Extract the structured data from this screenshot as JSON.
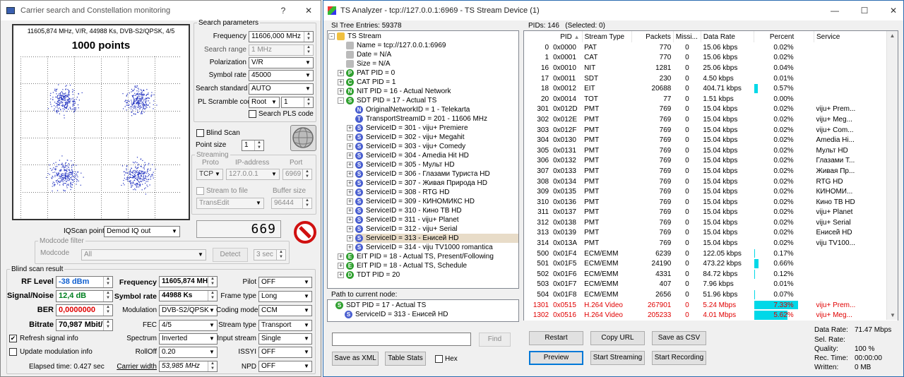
{
  "left_window": {
    "title": "Carrier search and Constellation monitoring",
    "help": "?",
    "close": "✕",
    "constellation": {
      "header": "11605,874 MHz, V/R, 44988 Ks, DVB-S2/QPSK, 4/5",
      "points_label": "1000 points"
    },
    "search_params": {
      "legend": "Search parameters",
      "frequency_label": "Frequency",
      "frequency_value": "11606,000 MHz",
      "search_range_label": "Search range",
      "search_range_value": "1 MHz",
      "polarization_label": "Polarization",
      "polarization_value": "V/R",
      "symbol_rate_label": "Symbol rate",
      "symbol_rate_value": "45000",
      "search_standard_label": "Search standard",
      "search_standard_value": "AUTO",
      "pl_scramble_label": "PL Scramble code",
      "pl_scramble_mode": "Root",
      "pl_scramble_value": "1",
      "search_pls_label": "Search PLS code"
    },
    "blind_scan_label": "Blind Scan",
    "point_size_label": "Point size",
    "point_size_value": "1",
    "streaming": {
      "legend": "Streaming",
      "proto_label": "Proto",
      "ip_label": "IP-address",
      "port_label": "Port",
      "proto_value": "TCP",
      "ip_value": "127.0.0.1",
      "port_value": "6969",
      "stream_to_file_label": "Stream to file",
      "buffer_size_label": "Buffer size",
      "file_value": "TransEdit",
      "buffer_value": "96444"
    },
    "counter_value": "669",
    "iqscan_label": "IQScan point",
    "iqscan_value": "Demod IQ out",
    "modcode_filter": {
      "legend": "Modcode filter",
      "modcode_label": "Modcode",
      "modcode_value": "All",
      "detect_label": "Detect",
      "sec_value": "3 sec"
    },
    "blind_result": {
      "legend": "Blind scan result",
      "rf_level_label": "RF Level",
      "rf_level_value": "-38 dBm",
      "sn_label": "Signal/Noise",
      "sn_value": "12,4 dB",
      "ber_label": "BER",
      "ber_value": "0,0000000",
      "bitrate_label": "Bitrate",
      "bitrate_value": "70,987 Mbit/",
      "refresh_label": "Refresh signal info",
      "update_mod_label": "Update modulation info",
      "elapsed": "Elapsed time: 0.427 sec",
      "frequency_label": "Frequency",
      "frequency_value": "11605,874 MH",
      "symbol_rate_label": "Symbol rate",
      "symbol_rate_value": "44988 Ks",
      "modulation_label": "Modulation",
      "modulation_value": "DVB-S2/QPSK",
      "fec_label": "FEC",
      "fec_value": "4/5",
      "spectrum_label": "Spectrum",
      "spectrum_value": "Inverted",
      "rolloff_label": "RollOff",
      "rolloff_value": "0.20",
      "carrier_width_label": "Carrier width",
      "carrier_width_value": "53,985 MHz",
      "pilot_label": "Pilot",
      "pilot_value": "OFF",
      "frame_type_label": "Frame type",
      "frame_type_value": "Long",
      "coding_mode_label": "Coding mode",
      "coding_mode_value": "CCM",
      "stream_type_label": "Stream type",
      "stream_type_value": "Transport",
      "input_stream_label": "Input stream",
      "input_stream_value": "Single",
      "issyi_label": "ISSYI",
      "issyi_value": "OFF",
      "npd_label": "NPD",
      "npd_value": "OFF"
    }
  },
  "right_window": {
    "title": "TS Analyzer - tcp://127.0.0.1:6969 - TS Stream Device (1)",
    "minimize": "—",
    "maximize": "☐",
    "close": "✕",
    "si_tree_header": "SI Tree Entries: 59378",
    "tree": [
      {
        "icon": "folder",
        "text": "TS Stream",
        "level": 0,
        "exp": "-"
      },
      {
        "icon": "gray",
        "text": "Name = tcp://127.0.0.1:6969",
        "level": 1
      },
      {
        "icon": "gray",
        "text": "Date = N/A",
        "level": 1
      },
      {
        "icon": "gray",
        "text": "Size = N/A",
        "level": 1
      },
      {
        "icon": "P",
        "text": "PAT PID = 0",
        "level": 1,
        "exp": "+"
      },
      {
        "icon": "C",
        "text": "CAT PID = 1",
        "level": 1,
        "exp": "+"
      },
      {
        "icon": "N",
        "text": "NIT PID = 16 - Actual Network",
        "level": 1,
        "exp": "+"
      },
      {
        "icon": "S",
        "text": "SDT PID = 17 - Actual TS",
        "level": 1,
        "exp": "-"
      },
      {
        "icon": "N2",
        "text": "OriginalNetworkID = 1 - Telekarta",
        "level": 2
      },
      {
        "icon": "T",
        "text": "TransportStreamID = 201 - 11606 MHz",
        "level": 2
      },
      {
        "icon": "S2",
        "text": "ServiceID = 301 - viju+ Premiere",
        "level": 2,
        "exp": "+"
      },
      {
        "icon": "S2",
        "text": "ServiceID = 302 - viju+ Megahit",
        "level": 2,
        "exp": "+"
      },
      {
        "icon": "S2",
        "text": "ServiceID = 303 - viju+ Comedy",
        "level": 2,
        "exp": "+"
      },
      {
        "icon": "S2",
        "text": "ServiceID = 304 - Amedia Hit HD",
        "level": 2,
        "exp": "+"
      },
      {
        "icon": "S2",
        "text": "ServiceID = 305 - Мульт HD",
        "level": 2,
        "exp": "+"
      },
      {
        "icon": "S2",
        "text": "ServiceID = 306 - Глазами Туриста HD",
        "level": 2,
        "exp": "+"
      },
      {
        "icon": "S2",
        "text": "ServiceID = 307 - Живая Природа HD",
        "level": 2,
        "exp": "+"
      },
      {
        "icon": "S2",
        "text": "ServiceID = 308 - RTG HD",
        "level": 2,
        "exp": "+"
      },
      {
        "icon": "S2",
        "text": "ServiceID = 309 - КИНОМИКС HD",
        "level": 2,
        "exp": "+"
      },
      {
        "icon": "S2",
        "text": "ServiceID = 310 - Кино ТВ HD",
        "level": 2,
        "exp": "+"
      },
      {
        "icon": "S2",
        "text": "ServiceID = 311 - viju+ Planet",
        "level": 2,
        "exp": "+"
      },
      {
        "icon": "S2",
        "text": "ServiceID = 312 - viju+ Serial",
        "level": 2,
        "exp": "+"
      },
      {
        "icon": "S2",
        "text": "ServiceID = 313 - Енисей HD",
        "level": 2,
        "exp": "+",
        "selected": true
      },
      {
        "icon": "S2",
        "text": "ServiceID = 314 - viju TV1000 romantica",
        "level": 2,
        "exp": "+"
      },
      {
        "icon": "E",
        "text": "EIT PID = 18 - Actual TS, Present/Following",
        "level": 1,
        "exp": "+"
      },
      {
        "icon": "E",
        "text": "EIT PID = 18 - Actual TS, Schedule",
        "level": 1,
        "exp": "+"
      },
      {
        "icon": "D",
        "text": "TDT PID = 20",
        "level": 1,
        "exp": "+"
      }
    ],
    "path_header": "Path to current node:",
    "path": [
      {
        "icon": "S",
        "text": "SDT PID = 17 - Actual TS"
      },
      {
        "icon": "S2",
        "text": "ServiceID = 313 - Енисей HD"
      }
    ],
    "find_label": "Find",
    "save_xml_label": "Save as XML",
    "table_stats_label": "Table Stats",
    "hex_label": "Hex",
    "pids_header": "PIDs: 146   (Selected: 0)",
    "columns": [
      "PID",
      "Stream Type",
      "Packets",
      "Missi...",
      "Data Rate",
      "Percent",
      "Service"
    ],
    "rows": [
      {
        "pid": "0",
        "hex": "0x0000",
        "type": "PAT",
        "packets": "770",
        "missing": "0",
        "rate": "15.06 kbps",
        "pct": "0.02%",
        "bar": 0.002,
        "service": "",
        "red": false
      },
      {
        "pid": "1",
        "hex": "0x0001",
        "type": "CAT",
        "packets": "770",
        "missing": "0",
        "rate": "15.06 kbps",
        "pct": "0.02%",
        "bar": 0.002,
        "service": "",
        "red": false
      },
      {
        "pid": "16",
        "hex": "0x0010",
        "type": "NIT",
        "packets": "1281",
        "missing": "0",
        "rate": "25.06 kbps",
        "pct": "0.04%",
        "bar": 0.004,
        "service": "",
        "red": false
      },
      {
        "pid": "17",
        "hex": "0x0011",
        "type": "SDT",
        "packets": "230",
        "missing": "0",
        "rate": "4.50 kbps",
        "pct": "0.01%",
        "bar": 0.001,
        "service": "",
        "red": false
      },
      {
        "pid": "18",
        "hex": "0x0012",
        "type": "EIT",
        "packets": "20688",
        "missing": "0",
        "rate": "404.71 kbps",
        "pct": "0.57%",
        "bar": 0.057,
        "service": "",
        "red": false
      },
      {
        "pid": "20",
        "hex": "0x0014",
        "type": "TOT",
        "packets": "77",
        "missing": "0",
        "rate": "1.51 kbps",
        "pct": "0.00%",
        "bar": 0,
        "service": "",
        "red": false
      },
      {
        "pid": "301",
        "hex": "0x012D",
        "type": "PMT",
        "packets": "769",
        "missing": "0",
        "rate": "15.04 kbps",
        "pct": "0.02%",
        "bar": 0.002,
        "service": "viju+ Prem...",
        "red": false
      },
      {
        "pid": "302",
        "hex": "0x012E",
        "type": "PMT",
        "packets": "769",
        "missing": "0",
        "rate": "15.04 kbps",
        "pct": "0.02%",
        "bar": 0.002,
        "service": "viju+ Meg...",
        "red": false
      },
      {
        "pid": "303",
        "hex": "0x012F",
        "type": "PMT",
        "packets": "769",
        "missing": "0",
        "rate": "15.04 kbps",
        "pct": "0.02%",
        "bar": 0.002,
        "service": "viju+ Com...",
        "red": false
      },
      {
        "pid": "304",
        "hex": "0x0130",
        "type": "PMT",
        "packets": "769",
        "missing": "0",
        "rate": "15.04 kbps",
        "pct": "0.02%",
        "bar": 0.002,
        "service": "Amedia Hi...",
        "red": false
      },
      {
        "pid": "305",
        "hex": "0x0131",
        "type": "PMT",
        "packets": "769",
        "missing": "0",
        "rate": "15.04 kbps",
        "pct": "0.02%",
        "bar": 0.002,
        "service": "Мульт HD",
        "red": false
      },
      {
        "pid": "306",
        "hex": "0x0132",
        "type": "PMT",
        "packets": "769",
        "missing": "0",
        "rate": "15.04 kbps",
        "pct": "0.02%",
        "bar": 0.002,
        "service": "Глазами Т...",
        "red": false
      },
      {
        "pid": "307",
        "hex": "0x0133",
        "type": "PMT",
        "packets": "769",
        "missing": "0",
        "rate": "15.04 kbps",
        "pct": "0.02%",
        "bar": 0.002,
        "service": "Живая Пр...",
        "red": false
      },
      {
        "pid": "308",
        "hex": "0x0134",
        "type": "PMT",
        "packets": "769",
        "missing": "0",
        "rate": "15.04 kbps",
        "pct": "0.02%",
        "bar": 0.002,
        "service": "RTG HD",
        "red": false
      },
      {
        "pid": "309",
        "hex": "0x0135",
        "type": "PMT",
        "packets": "769",
        "missing": "0",
        "rate": "15.04 kbps",
        "pct": "0.02%",
        "bar": 0.002,
        "service": "КИНОМИ...",
        "red": false
      },
      {
        "pid": "310",
        "hex": "0x0136",
        "type": "PMT",
        "packets": "769",
        "missing": "0",
        "rate": "15.04 kbps",
        "pct": "0.02%",
        "bar": 0.002,
        "service": "Кино ТВ HD",
        "red": false
      },
      {
        "pid": "311",
        "hex": "0x0137",
        "type": "PMT",
        "packets": "769",
        "missing": "0",
        "rate": "15.04 kbps",
        "pct": "0.02%",
        "bar": 0.002,
        "service": "viju+ Planet",
        "red": false
      },
      {
        "pid": "312",
        "hex": "0x0138",
        "type": "PMT",
        "packets": "769",
        "missing": "0",
        "rate": "15.04 kbps",
        "pct": "0.02%",
        "bar": 0.002,
        "service": "viju+ Serial",
        "red": false
      },
      {
        "pid": "313",
        "hex": "0x0139",
        "type": "PMT",
        "packets": "769",
        "missing": "0",
        "rate": "15.04 kbps",
        "pct": "0.02%",
        "bar": 0.002,
        "service": "Енисей HD",
        "red": false
      },
      {
        "pid": "314",
        "hex": "0x013A",
        "type": "PMT",
        "packets": "769",
        "missing": "0",
        "rate": "15.04 kbps",
        "pct": "0.02%",
        "bar": 0.002,
        "service": "viju TV100...",
        "red": false
      },
      {
        "pid": "500",
        "hex": "0x01F4",
        "type": "ECM/EMM",
        "packets": "6239",
        "missing": "0",
        "rate": "122.05 kbps",
        "pct": "0.17%",
        "bar": 0.017,
        "service": "",
        "red": false
      },
      {
        "pid": "501",
        "hex": "0x01F5",
        "type": "ECM/EMM",
        "packets": "24190",
        "missing": "0",
        "rate": "473.22 kbps",
        "pct": "0.66%",
        "bar": 0.066,
        "service": "",
        "red": false
      },
      {
        "pid": "502",
        "hex": "0x01F6",
        "type": "ECM/EMM",
        "packets": "4331",
        "missing": "0",
        "rate": "84.72 kbps",
        "pct": "0.12%",
        "bar": 0.012,
        "service": "",
        "red": false
      },
      {
        "pid": "503",
        "hex": "0x01F7",
        "type": "ECM/EMM",
        "packets": "407",
        "missing": "0",
        "rate": "7.96 kbps",
        "pct": "0.01%",
        "bar": 0.001,
        "service": "",
        "red": false
      },
      {
        "pid": "504",
        "hex": "0x01F8",
        "type": "ECM/EMM",
        "packets": "2656",
        "missing": "0",
        "rate": "51.96 kbps",
        "pct": "0.07%",
        "bar": 0.007,
        "service": "",
        "red": false
      },
      {
        "pid": "1301",
        "hex": "0x0515",
        "type": "H.264 Video",
        "packets": "267901",
        "missing": "0",
        "rate": "5.24 Mbps",
        "pct": "7.33%",
        "bar": 0.733,
        "service": "viju+ Prem...",
        "red": true
      },
      {
        "pid": "1302",
        "hex": "0x0516",
        "type": "H.264 Video",
        "packets": "205233",
        "missing": "0",
        "rate": "4.01 Mbps",
        "pct": "5.62%",
        "bar": 0.562,
        "service": "viju+ Meg...",
        "red": true
      }
    ],
    "buttons": {
      "restart": "Restart",
      "copy_url": "Copy URL",
      "save_csv": "Save as CSV",
      "preview": "Preview",
      "start_streaming": "Start Streaming",
      "start_recording": "Start Recording"
    },
    "stats": {
      "data_rate_label": "Data Rate:",
      "data_rate_value": "71.47 Mbps",
      "sel_rate_label": "Sel. Rate:",
      "sel_rate_value": "",
      "quality_label": "Quality:",
      "quality_value": "100 %",
      "rec_time_label": "Rec. Time:",
      "rec_time_value": "00:00:00",
      "written_label": "Written:",
      "written_value": "0 MB"
    },
    "colors": {
      "bar": "#00d8e8",
      "red_row": "#e00000",
      "selected_row": "#e8dcc8"
    }
  }
}
